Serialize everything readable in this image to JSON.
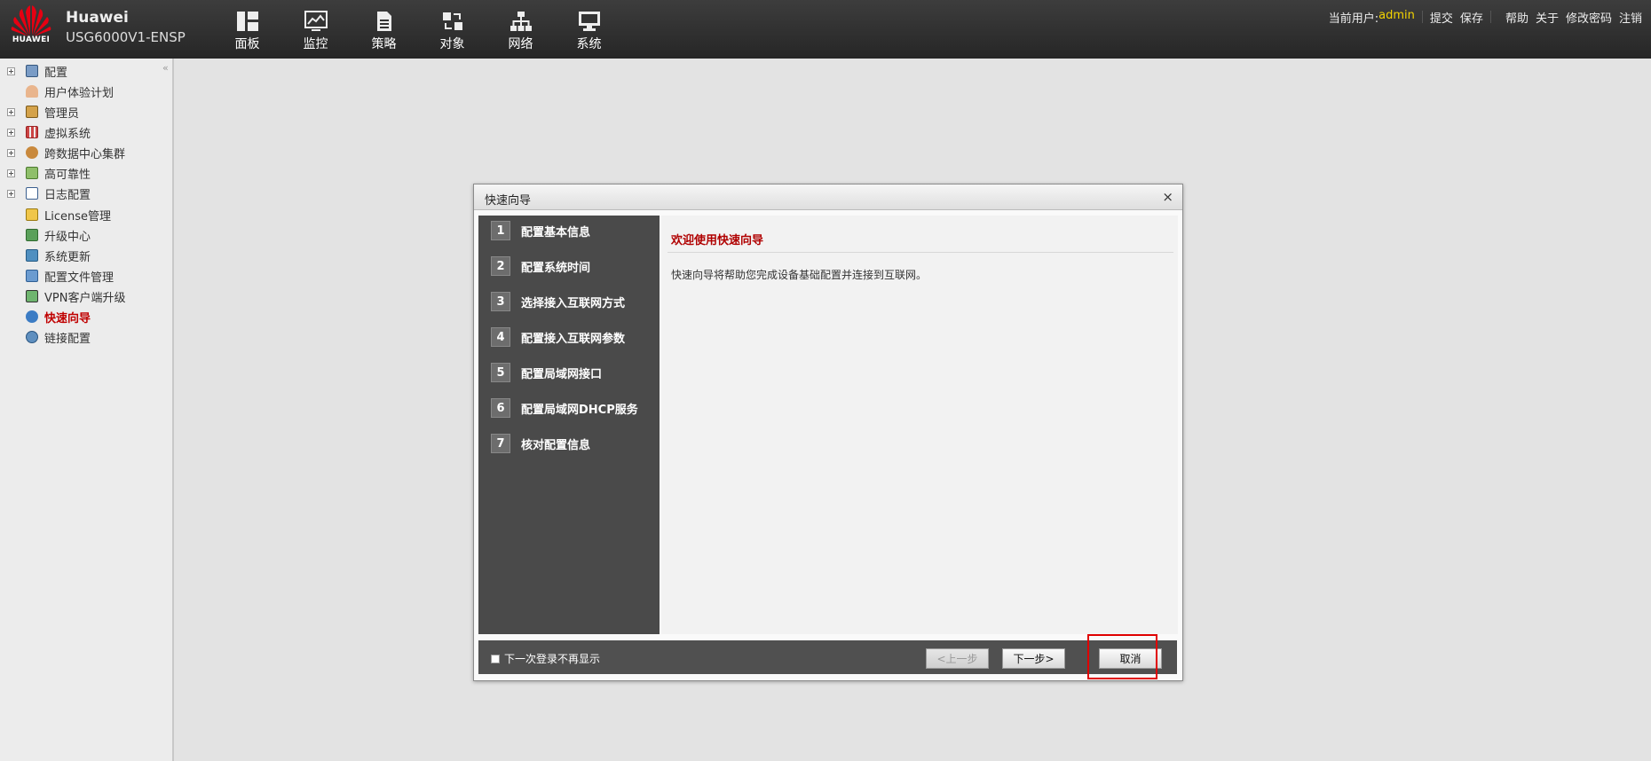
{
  "header": {
    "logo_text": "HUAWEI",
    "brand": "Huawei",
    "model": "USG6000V1-ENSP",
    "nav": [
      {
        "label": "面板",
        "icon": "dashboard-icon"
      },
      {
        "label": "监控",
        "icon": "monitor-icon"
      },
      {
        "label": "策略",
        "icon": "policy-icon"
      },
      {
        "label": "对象",
        "icon": "object-icon"
      },
      {
        "label": "网络",
        "icon": "network-icon"
      },
      {
        "label": "系统",
        "icon": "system-icon"
      }
    ],
    "user_label": "当前用户:",
    "user_name": "admin",
    "links": {
      "commit": "提交",
      "save": "保存",
      "help": "帮助",
      "about": "关于",
      "change_password": "修改密码",
      "logout": "注销"
    },
    "accent_color": "#f3d300"
  },
  "sidebar": {
    "collapse_glyph": "«",
    "items": [
      {
        "label": "配置",
        "expandable": true,
        "icon": "config-icon"
      },
      {
        "label": "用户体验计划",
        "expandable": false,
        "icon": "user-experience-icon"
      },
      {
        "label": "管理员",
        "expandable": true,
        "icon": "admin-icon"
      },
      {
        "label": "虚拟系统",
        "expandable": true,
        "icon": "virtual-system-icon"
      },
      {
        "label": "跨数据中心集群",
        "expandable": true,
        "icon": "cluster-icon"
      },
      {
        "label": "高可靠性",
        "expandable": true,
        "icon": "high-availability-icon"
      },
      {
        "label": "日志配置",
        "expandable": true,
        "icon": "log-config-icon"
      },
      {
        "label": "License管理",
        "expandable": false,
        "icon": "license-icon"
      },
      {
        "label": "升级中心",
        "expandable": false,
        "icon": "upgrade-center-icon"
      },
      {
        "label": "系统更新",
        "expandable": false,
        "icon": "system-update-icon"
      },
      {
        "label": "配置文件管理",
        "expandable": false,
        "icon": "config-file-icon"
      },
      {
        "label": "VPN客户端升级",
        "expandable": false,
        "icon": "vpn-client-icon"
      },
      {
        "label": "快速向导",
        "expandable": false,
        "icon": "quick-wizard-icon",
        "active": true
      },
      {
        "label": "链接配置",
        "expandable": false,
        "icon": "link-config-icon"
      }
    ]
  },
  "dialog": {
    "title": "快速向导",
    "close_glyph": "×",
    "steps": [
      {
        "num": "1",
        "label": "配置基本信息"
      },
      {
        "num": "2",
        "label": "配置系统时间"
      },
      {
        "num": "3",
        "label": "选择接入互联网方式"
      },
      {
        "num": "4",
        "label": "配置接入互联网参数"
      },
      {
        "num": "5",
        "label": "配置局域网接口"
      },
      {
        "num": "6",
        "label": "配置局域网DHCP服务"
      },
      {
        "num": "7",
        "label": "核对配置信息"
      }
    ],
    "heading": "欢迎使用快速向导",
    "description": "快速向导将帮助您完成设备基础配置并连接到互联网。",
    "dont_show_label": "下一次登录不再显示",
    "dont_show_checked": false,
    "prev_label": "<上一步",
    "next_label": "下一步>",
    "cancel_label": "取消",
    "highlight_color": "#e00000"
  }
}
